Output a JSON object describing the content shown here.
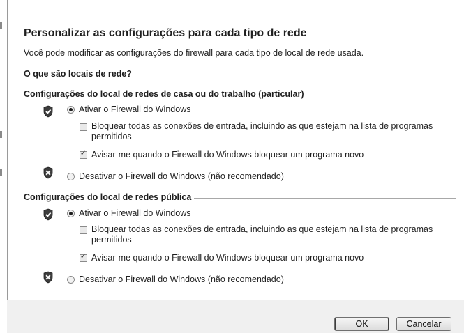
{
  "dialog": {
    "title": "Personalizar as configurações para cada tipo de rede",
    "description": "Você pode modificar as configurações do firewall para cada tipo de local de rede usada.",
    "link": "O que são locais de rede?"
  },
  "private_section": {
    "header": "Configurações do local de redes de casa ou do trabalho (particular)",
    "enable_label": "Ativar o Firewall do Windows",
    "enable_selected": true,
    "block_all_label": "Bloquear todas as conexões de entrada, incluindo as que estejam na lista de programas permitidos",
    "block_all_checked": false,
    "notify_label": "Avisar-me quando o Firewall do Windows bloquear um programa novo",
    "notify_checked": true,
    "disable_label": "Desativar o Firewall do Windows (não recomendado)"
  },
  "public_section": {
    "header": "Configurações do local de redes pública",
    "enable_label": "Ativar o Firewall do Windows",
    "enable_selected": true,
    "block_all_label": "Bloquear todas as conexões de entrada, incluindo as que estejam na lista de programas permitidos",
    "block_all_checked": false,
    "notify_label": "Avisar-me quando o Firewall do Windows bloquear um programa novo",
    "notify_checked": true,
    "disable_label": "Desativar o Firewall do Windows (não recomendado)"
  },
  "buttons": {
    "ok": "OK",
    "cancel": "Cancelar"
  },
  "icons": {
    "enabled": "shield-check-icon",
    "disabled": "shield-x-icon"
  }
}
